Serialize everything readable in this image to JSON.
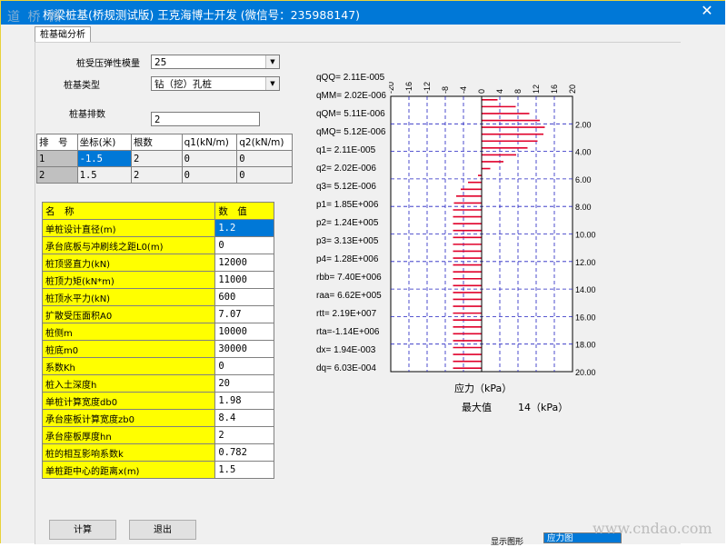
{
  "window": {
    "title": "桥梁桩基(桥规测试版) 王克海博士开发 (微信号：235988147)",
    "close_glyph": "✕",
    "watermark_tl": "道 桥 微",
    "watermark_br": "www.cndao.com"
  },
  "tab": {
    "label": "桩基础分析"
  },
  "form": {
    "elastic_label": "桩受压弹性模量",
    "elastic_value": "25",
    "pile_type_label": "桩基类型",
    "pile_type_value": "钻（挖）孔桩",
    "rows_label": "桩基排数",
    "rows_value": "2"
  },
  "pile_table": {
    "headers": [
      "排　号",
      "坐标(米)",
      "根数",
      "q1(kN/m)",
      "q2(kN/m)"
    ],
    "rows": [
      [
        "1",
        "-1.5",
        "2",
        "0",
        "0"
      ],
      [
        "2",
        "1.5",
        "2",
        "0",
        "0"
      ]
    ]
  },
  "param_table": {
    "headers": [
      "名　称",
      "数　值"
    ],
    "rows": [
      [
        "单桩设计直径(m)",
        "1.2"
      ],
      [
        "承台底板与冲刷线之距L0(m)",
        "0"
      ],
      [
        "桩顶竖直力(kN)",
        "12000"
      ],
      [
        "桩顶力矩(kN*m)",
        "11000"
      ],
      [
        "桩顶水平力(kN)",
        "600"
      ],
      [
        "扩散受压面积A0",
        "7.07"
      ],
      [
        "桩侧m",
        "10000"
      ],
      [
        "桩底m0",
        "30000"
      ],
      [
        "系数Kh",
        "0"
      ],
      [
        "桩入土深度h",
        "20"
      ],
      [
        "单桩计算宽度db0",
        "1.98"
      ],
      [
        "承台座板计算宽度zb0",
        "8.4"
      ],
      [
        "承台座板厚度hn",
        "2"
      ],
      [
        "桩的相互影响系数k",
        "0.782"
      ],
      [
        "单桩距中心的距离x(m)",
        "1.5"
      ]
    ]
  },
  "stats": [
    "qQQ= 2.11E-005",
    "qMM= 2.02E-006",
    "qQM= 5.11E-006",
    "qMQ= 5.12E-006",
    "q1= 2.11E-005",
    "q2= 2.02E-006",
    "q3= 5.12E-006",
    "p1= 1.85E+006",
    "p2= 1.24E+005",
    "p3= 3.13E+005",
    "p4= 1.28E+006",
    "rbb= 7.40E+006",
    "raa= 6.62E+005",
    "rtt= 2.19E+007",
    "rta=-1.14E+006",
    "dx= 1.94E-003",
    "dq= 6.03E-004"
  ],
  "chart": {
    "x_ticks": [
      "-20",
      "-16",
      "-12",
      "-8",
      "-4",
      "0",
      "4",
      "8",
      "12",
      "16",
      "20"
    ],
    "y_ticks": [
      "2.00",
      "4.00",
      "6.00",
      "8.00",
      "10.00",
      "12.00",
      "14.00",
      "16.00",
      "18.00",
      "20.00"
    ],
    "xlabel": "应力（kPa）",
    "max_label": "最大值",
    "max_value": "14（kPa）",
    "bar_color": "#e0002a"
  },
  "chart_data": {
    "type": "bar",
    "orientation": "horizontal",
    "xlabel": "应力（kPa）",
    "xlim": [
      -20,
      20
    ],
    "ylim": [
      0,
      20
    ],
    "x_ticks": [
      -20,
      -16,
      -12,
      -8,
      -4,
      0,
      4,
      8,
      12,
      16,
      20
    ],
    "y_ticks": [
      2,
      4,
      6,
      8,
      10,
      12,
      14,
      16,
      18,
      20
    ],
    "depth": [
      0.5,
      1.0,
      1.5,
      2.0,
      2.5,
      3.0,
      3.5,
      4.0,
      4.5,
      5.0,
      5.5,
      6.0,
      6.5,
      7.0,
      7.5,
      8.0,
      8.5,
      9.0,
      9.5,
      10.0,
      10.5,
      11.0,
      11.5,
      12.0,
      12.5,
      13.0,
      13.5,
      14.0,
      14.5,
      15.0,
      15.5,
      16.0,
      16.5,
      17.0,
      17.5,
      18.0,
      18.5,
      19.0,
      19.5,
      20.0
    ],
    "stress": [
      3.5,
      7.5,
      10.5,
      12.8,
      13.9,
      13.6,
      12.3,
      10.1,
      7.6,
      4.8,
      1.9,
      -0.8,
      -3.0,
      -4.6,
      -5.6,
      -6.1,
      -6.3,
      -6.3,
      -6.3,
      -6.3,
      -6.3,
      -6.3,
      -6.3,
      -6.3,
      -6.3,
      -6.3,
      -6.3,
      -6.3,
      -6.3,
      -6.3,
      -6.3,
      -6.3,
      -6.3,
      -6.3,
      -6.3,
      -6.3,
      -6.3,
      -6.3,
      -6.3,
      -6.3
    ],
    "max": 14,
    "grid": true
  },
  "buttons": {
    "calc": "计算",
    "exit": "退出"
  },
  "display": {
    "label": "显示图形",
    "value": "应力图"
  }
}
